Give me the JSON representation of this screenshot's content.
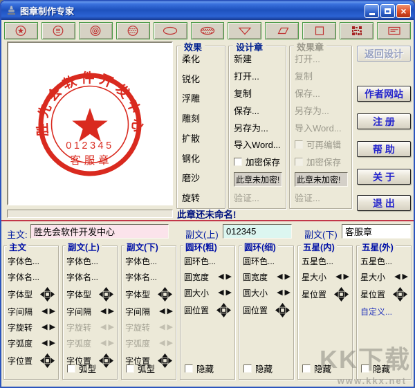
{
  "window": {
    "title": "图章制作专家",
    "controls": [
      "minimize",
      "maximize",
      "close"
    ]
  },
  "toolbar": {
    "buttons": [
      "stamp-round-star",
      "stamp-round-text",
      "stamp-round-rings",
      "stamp-round-striped",
      "stamp-ellipse",
      "stamp-ellipse-striped",
      "stamp-triangle",
      "stamp-parallelogram",
      "stamp-square",
      "stamp-pattern",
      "stamp-card"
    ]
  },
  "preview": {
    "stamp": {
      "arc_text": "胜先会软件开发中心",
      "number": "012345",
      "bottom_text": "客服章"
    }
  },
  "effects": {
    "title": "效果",
    "items": [
      "柔化",
      "锐化",
      "浮雕",
      "雕刻",
      "扩散",
      "钢化",
      "磨沙",
      "旋转"
    ]
  },
  "design_group": {
    "title": "设计章",
    "items": [
      "新建",
      "打开...",
      "复制",
      "保存...",
      "另存为...",
      "导入Word..."
    ],
    "encrypt_checkbox": "加密保存",
    "status": "此章未加密!",
    "verify": "验证..."
  },
  "effect_group": {
    "title": "效果章",
    "items": [
      "打开...",
      "复制",
      "保存...",
      "另存为...",
      "导入Word..."
    ],
    "editable_checkbox": "可再编辑",
    "encrypt_checkbox": "加密保存",
    "status": "此章未加密!",
    "verify": "验证..."
  },
  "side_buttons": [
    {
      "label": "返回设计",
      "disabled": true
    },
    {
      "label": "作者网站",
      "disabled": false
    },
    {
      "label": "注 册",
      "disabled": false
    },
    {
      "label": "帮 助",
      "disabled": false
    },
    {
      "label": "关 于",
      "disabled": false
    },
    {
      "label": "退 出",
      "disabled": false
    }
  ],
  "status_text": "此章还未命名!",
  "inputs": {
    "main_label": "主文:",
    "main_value": "胜先会软件开发中心",
    "sub_top_label": "副文(上)",
    "sub_top_value": "012345",
    "sub_bottom_label": "副文(下)",
    "sub_bottom_value": "客服章"
  },
  "panels": [
    {
      "title": "主文",
      "checkbox": null,
      "rows": [
        {
          "label": "字体色...",
          "control": "none"
        },
        {
          "label": "字体名...",
          "control": "none"
        },
        {
          "label": "字体型",
          "control": "pad"
        },
        {
          "label": "字间隔",
          "control": "spin"
        },
        {
          "label": "字旋转",
          "control": "spin"
        },
        {
          "label": "字弧度",
          "control": "spin"
        },
        {
          "label": "字位置",
          "control": "pad"
        }
      ]
    },
    {
      "title": "副文(上)",
      "checkbox": "弧型",
      "rows": [
        {
          "label": "字体色...",
          "control": "none"
        },
        {
          "label": "字体名...",
          "control": "none"
        },
        {
          "label": "字体型",
          "control": "pad"
        },
        {
          "label": "字间隔",
          "control": "spin"
        },
        {
          "label": "字旋转",
          "control": "spin",
          "disabled": true
        },
        {
          "label": "字弧度",
          "control": "spin",
          "disabled": true
        },
        {
          "label": "字位置",
          "control": "pad"
        }
      ]
    },
    {
      "title": "副文(下)",
      "checkbox": "弧型",
      "rows": [
        {
          "label": "字体色...",
          "control": "none"
        },
        {
          "label": "字体名...",
          "control": "none"
        },
        {
          "label": "字体型",
          "control": "pad"
        },
        {
          "label": "字间隔",
          "control": "spin"
        },
        {
          "label": "字旋转",
          "control": "spin",
          "disabled": true
        },
        {
          "label": "字弧度",
          "control": "spin",
          "disabled": true
        },
        {
          "label": "字位置",
          "control": "pad"
        }
      ]
    },
    {
      "title": "圆环(粗)",
      "checkbox": "隐藏",
      "rows": [
        {
          "label": "圆环色...",
          "control": "none"
        },
        {
          "label": "圆宽度",
          "control": "spin"
        },
        {
          "label": "圆大小",
          "control": "spin"
        },
        {
          "label": "圆位置",
          "control": "pad"
        }
      ]
    },
    {
      "title": "圆环(细)",
      "checkbox": "隐藏",
      "rows": [
        {
          "label": "圆环色...",
          "control": "none"
        },
        {
          "label": "圆宽度",
          "control": "spin"
        },
        {
          "label": "圆大小",
          "control": "spin"
        },
        {
          "label": "圆位置",
          "control": "pad"
        }
      ]
    },
    {
      "title": "五星(内)",
      "checkbox": "隐藏",
      "rows": [
        {
          "label": "五星色...",
          "control": "none"
        },
        {
          "label": "星大小",
          "control": "spin"
        },
        {
          "label": "星位置",
          "control": "pad"
        }
      ]
    },
    {
      "title": "五星(外)",
      "checkbox": "隐藏",
      "rows": [
        {
          "label": "五星色...",
          "control": "none"
        },
        {
          "label": "星大小",
          "control": "spin"
        },
        {
          "label": "星位置",
          "control": "pad"
        },
        {
          "label": "自定义...",
          "control": "none",
          "accent": true
        }
      ]
    }
  ],
  "watermark": {
    "line1": "KK下载",
    "line2": "www.kkx.net"
  },
  "colors": {
    "stamp_red": "#D92A1F",
    "toolbar_icon_red": "#BF3030",
    "toolbar_border_green": "#4C9A47",
    "accent_text_blue": "#2424CC",
    "group_title_blue": "#002090",
    "status_text_navy": "#00127E",
    "separator_red": "#C23648",
    "input_main_bg": "#FBE3EB",
    "input_subtop_bg": "#DCF6F0",
    "titlebar_blue": "#1E51BD",
    "window_bg": "#ECE9D8"
  }
}
